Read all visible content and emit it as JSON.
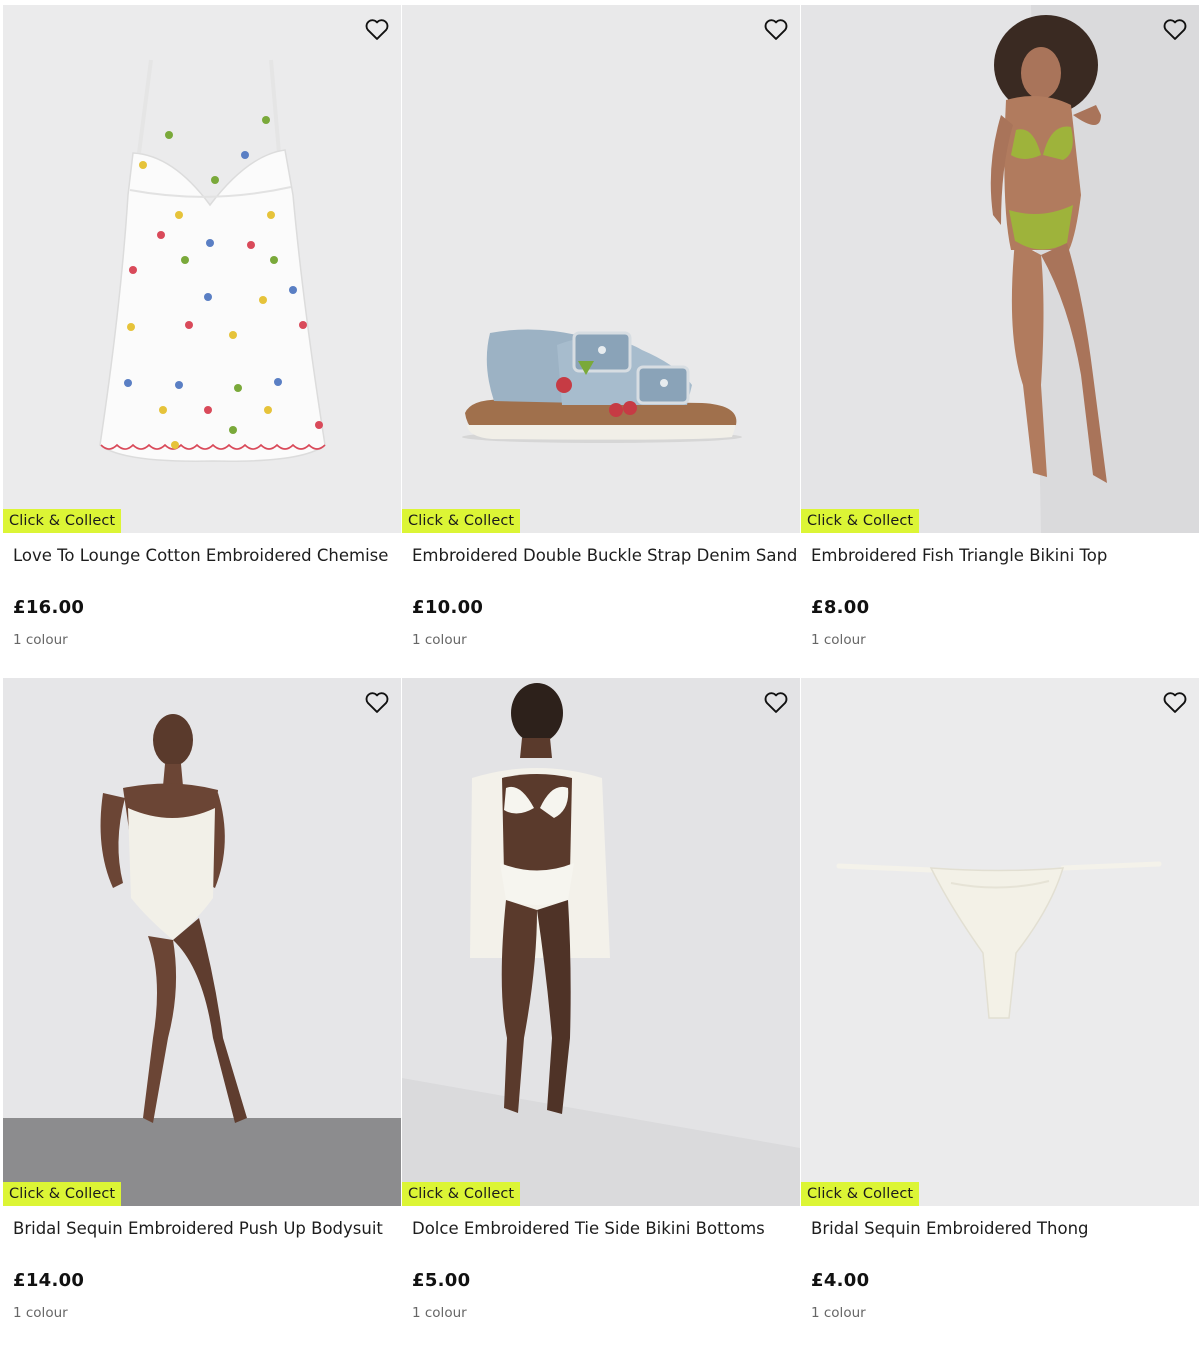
{
  "colors": {
    "badge_bg": "#dcf535",
    "image_bg": "#ebebec",
    "text": "#1d1d1d"
  },
  "products": [
    {
      "title": "Love To Lounge Cotton Embroidered Chemise",
      "price": "£16.00",
      "colours": "1 colour",
      "badge": "Click & Collect",
      "wishlist_icon": "heart-outline-icon"
    },
    {
      "title": "Embroidered Double Buckle Strap Denim Sandals",
      "price": "£10.00",
      "colours": "1 colour",
      "badge": "Click & Collect",
      "wishlist_icon": "heart-outline-icon"
    },
    {
      "title": "Embroidered Fish Triangle Bikini Top",
      "price": "£8.00",
      "colours": "1 colour",
      "badge": "Click & Collect",
      "wishlist_icon": "heart-outline-icon"
    },
    {
      "title": "Bridal Sequin Embroidered Push Up Bodysuit",
      "price": "£14.00",
      "colours": "1 colour",
      "badge": "Click & Collect",
      "wishlist_icon": "heart-outline-icon"
    },
    {
      "title": "Dolce Embroidered Tie Side Bikini Bottoms",
      "price": "£5.00",
      "colours": "1 colour",
      "badge": "Click & Collect",
      "wishlist_icon": "heart-outline-icon"
    },
    {
      "title": "Bridal Sequin Embroidered Thong",
      "price": "£4.00",
      "colours": "1 colour",
      "badge": "Click & Collect",
      "wishlist_icon": "heart-outline-icon"
    }
  ]
}
